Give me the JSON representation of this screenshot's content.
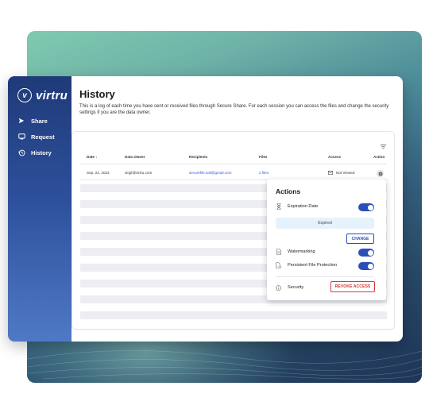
{
  "brand": {
    "logo_mark": "v",
    "name": "virtru"
  },
  "sidebar": {
    "items": [
      {
        "label": "Share",
        "icon": "send-icon"
      },
      {
        "label": "Request",
        "icon": "inbox-icon"
      },
      {
        "label": "History",
        "icon": "history-icon"
      }
    ]
  },
  "page": {
    "title": "History",
    "description": "This is a log of each time you have sent or received files through Secure Share. For each session you can access the files and change the security settings if you are the data owner."
  },
  "table": {
    "columns": [
      "Date ↓",
      "Data Owner",
      "Recipients",
      "Files",
      "Access",
      "Action"
    ],
    "row": {
      "date": "Sep. 22, 2023",
      "owner": "virgil@virtru.com",
      "recipients": "securefile.sail@gmail.com",
      "files": "2 files",
      "access": "Not Viewed"
    }
  },
  "actions": {
    "title": "Actions",
    "expiration_label": "Expiration Date",
    "expired_text": "Expired",
    "change_label": "CHANGE",
    "watermarking_label": "Watermarking",
    "pfp_label": "Persistent File Protection",
    "security_label": "Security",
    "revoke_label": "REVOKE ACCESS",
    "expiration_enabled": true,
    "watermarking_enabled": true,
    "pfp_enabled": true
  },
  "colors": {
    "accent": "#2b4fb8",
    "danger": "#d33a3a",
    "sidebar": "#2d4f9a"
  }
}
